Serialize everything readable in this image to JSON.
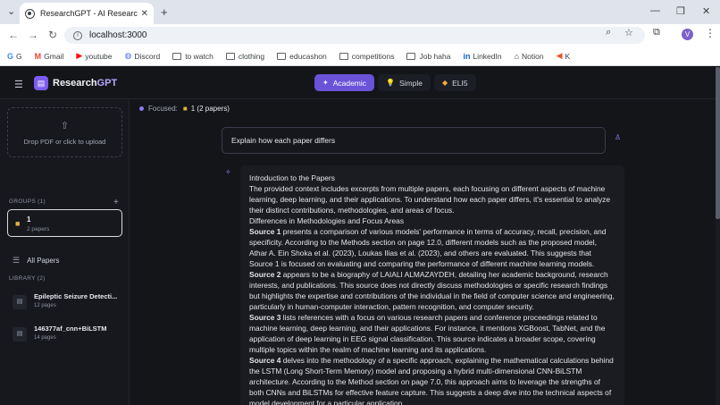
{
  "browser": {
    "tab_title": "ResearchGPT - AI Research Pap",
    "tab_close": "✕",
    "new_tab": "+",
    "tab_list": "⌄",
    "win_min": "—",
    "win_max": "❐",
    "win_close": "✕",
    "url": "localhost:3000",
    "profile_initial": "V",
    "bookmarks": [
      {
        "label": "G",
        "icon": "G"
      },
      {
        "label": "Gmail",
        "icon": "M"
      },
      {
        "label": "youtube",
        "icon": "▶"
      },
      {
        "label": "Discord",
        "icon": "◍"
      },
      {
        "label": "to watch",
        "icon": "folder"
      },
      {
        "label": "clothing",
        "icon": "folder"
      },
      {
        "label": "educashon",
        "icon": "folder"
      },
      {
        "label": "competitions",
        "icon": "folder"
      },
      {
        "label": "Job haha",
        "icon": "folder"
      },
      {
        "label": "LinkedIn",
        "icon": "in"
      },
      {
        "label": "Notion",
        "icon": "⌂"
      },
      {
        "label": "K",
        "icon": "◀"
      }
    ]
  },
  "app": {
    "brand_a": "Research",
    "brand_b": "GPT",
    "modes": [
      {
        "label": "Academic",
        "icon": "✦"
      },
      {
        "label": "Simple",
        "icon": "💡"
      },
      {
        "label": "ELI5",
        "icon": "◆"
      }
    ]
  },
  "sidebar": {
    "upload_text": "Drop PDF or click to upload",
    "groups_label": "GROUPS (1)",
    "group": {
      "name": "1",
      "count": "2 papers"
    },
    "all_papers": "All Papers",
    "library_label": "LIBRARY (2)",
    "library": [
      {
        "name": "Epileptic Seizure Detecti...",
        "pages": "12 pages"
      },
      {
        "name": "146377af_cnn+BiLSTM",
        "pages": "14 pages"
      }
    ]
  },
  "main": {
    "focused_label": "Focused:",
    "focused_value": "1 (2 papers)",
    "question": "Explain how each paper differs",
    "answer": {
      "heading1": "Introduction to the Papers",
      "intro": "The provided context includes excerpts from multiple papers, each focusing on different aspects of machine learning, deep learning, and their applications. To understand how each paper differs, it's essential to analyze their distinct contributions, methodologies, and areas of focus.",
      "heading2": "Differences in Methodologies and Focus Areas",
      "s1_label": "Source 1",
      "s1_text": " presents a comparison of various models' performance in terms of accuracy, recall, precision, and specificity. According to the Methods section on page 12.0, different models such as the proposed model, Athar A. Ein Shoka et al. (2023), Loukas Ilias et al. (2023), and others are evaluated. This suggests that Source 1 is focused on evaluating and comparing the performance of different machine learning models.",
      "s2_label": "Source 2",
      "s2_text": " appears to be a biography of LAIALI ALMAZAYDEH, detailing her academic background, research interests, and publications. This source does not directly discuss methodologies or specific research findings but highlights the expertise and contributions of the individual in the field of computer science and engineering, particularly in human-computer interaction, pattern recognition, and computer security.",
      "s3_label": "Source 3",
      "s3_text": " lists references with a focus on various research papers and conference proceedings related to machine learning, deep learning, and their applications. For instance, it mentions XGBoost, TabNet, and the application of deep learning in EEG signal classification. This source indicates a broader scope, covering multiple topics within the realm of machine learning and its applications.",
      "s4_label": "Source 4",
      "s4_text": " delves into the methodology of a specific approach, explaining the mathematical calculations behind the LSTM (Long Short-Term Memory) model and proposing a hybrid multi-dimensional CNN-BiLSTM architecture. According to the Method section on page 7.0, this approach aims to leverage the strengths of both CNNs and BiLSTMs for effective feature capture. This suggests a deep dive into the technical aspects of model development for a particular application."
    }
  }
}
